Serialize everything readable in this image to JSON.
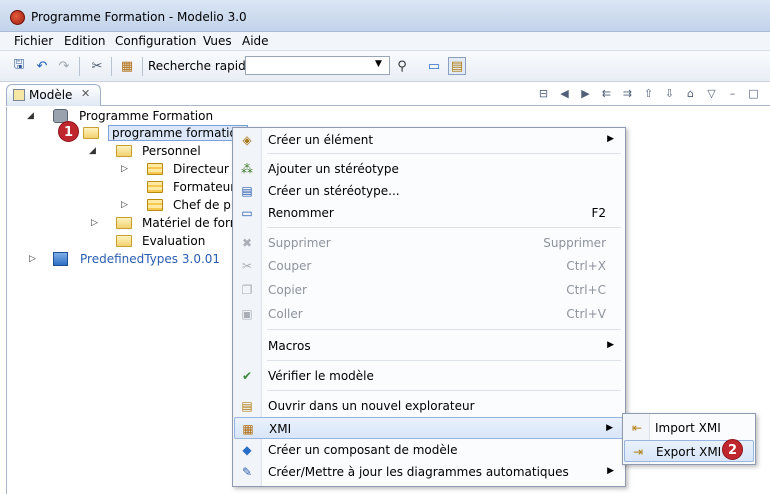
{
  "window": {
    "title": "Programme Formation - Modelio 3.0"
  },
  "menubar": {
    "items": [
      "Fichier",
      "Edition",
      "Configuration",
      "Vues",
      "Aide"
    ]
  },
  "toolbar": {
    "search_label": "Recherche rapide :",
    "search_value": ""
  },
  "view_tab": {
    "label": "Modèle",
    "close": "✕"
  },
  "tree": {
    "root": "Programme Formation",
    "selected": "programme formation",
    "personnel": "Personnel",
    "directeur": "Directeur d",
    "formateur": "Formateur",
    "chef": "Chef de pro",
    "materiel": "Matériel de forma",
    "evaluation": "Evaluation",
    "predefined": "PredefinedTypes 3.0.01"
  },
  "context_menu": {
    "creer_element": "Créer un élément",
    "ajouter_stereotype": "Ajouter un stéréotype",
    "creer_stereotype": "Créer un stéréotype...",
    "renommer": "Renommer",
    "renommer_key": "F2",
    "supprimer": "Supprimer",
    "supprimer_key": "Supprimer",
    "couper": "Couper",
    "couper_key": "Ctrl+X",
    "copier": "Copier",
    "copier_key": "Ctrl+C",
    "coller": "Coller",
    "coller_key": "Ctrl+V",
    "macros": "Macros",
    "verifier": "Vérifier le modèle",
    "ouvrir": "Ouvrir dans un nouvel explorateur",
    "xmi": "XMI",
    "creer_composant": "Créer un composant de modèle",
    "creer_diagrammes": "Créer/Mettre à jour les diagrammes automatiques"
  },
  "submenu": {
    "import_xmi": "Import XMI",
    "export_xmi": "Export XMI"
  },
  "badges": {
    "one": "1",
    "two": "2"
  },
  "colors": {
    "badge": "#c0262d",
    "selection": "#dce8fa",
    "link": "#2a5db0"
  }
}
